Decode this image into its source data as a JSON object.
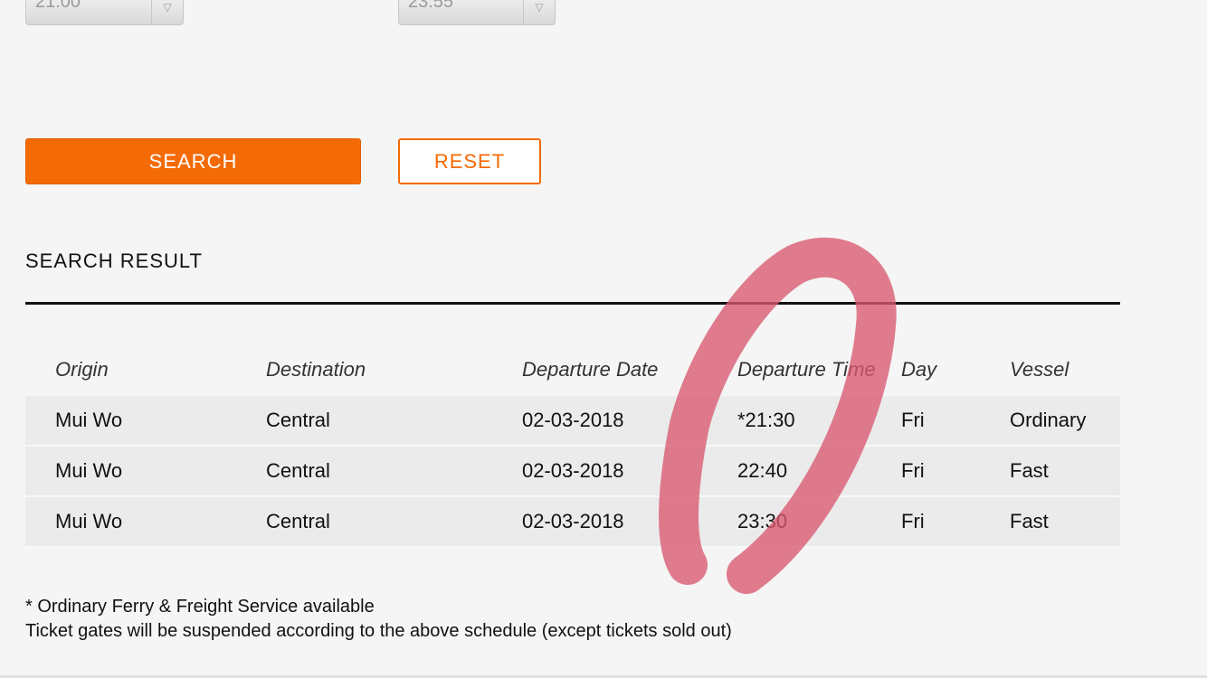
{
  "filters": {
    "time_from": "21:00",
    "time_to": "23:55"
  },
  "buttons": {
    "search": "SEARCH",
    "reset": "RESET"
  },
  "result": {
    "title": "SEARCH RESULT",
    "headers": [
      "Origin",
      "Destination",
      "Departure Date",
      "Departure Time",
      "Day",
      "Vessel"
    ],
    "rows": [
      [
        "Mui Wo",
        "Central",
        "02-03-2018",
        "*21:30",
        "Fri",
        "Ordinary"
      ],
      [
        "Mui Wo",
        "Central",
        "02-03-2018",
        "22:40",
        "Fri",
        "Fast"
      ],
      [
        "Mui Wo",
        "Central",
        "02-03-2018",
        "23:30",
        "Fri",
        "Fast"
      ]
    ]
  },
  "notes": {
    "line1": "* Ordinary Ferry & Freight Service available",
    "line2": "Ticket gates will be suspended according to the above schedule (except tickets sold out)"
  },
  "colors": {
    "accent": "#f46a05",
    "annotation": "#d9596f"
  }
}
